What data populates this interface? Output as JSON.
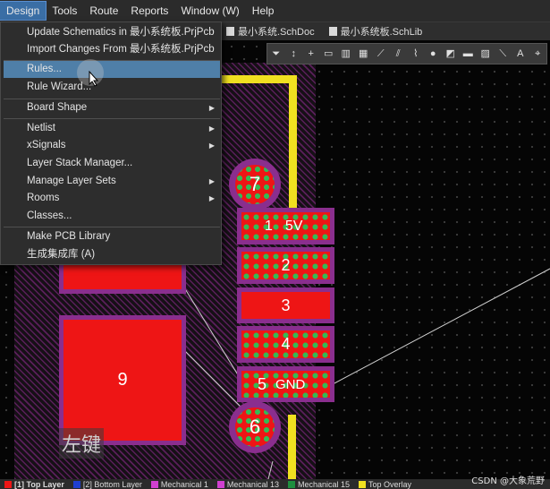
{
  "menubar": {
    "items": [
      "Design",
      "Tools",
      "Route",
      "Reports",
      "Window (W)",
      "Help"
    ]
  },
  "tabs": [
    "最小系统.SchDoc",
    "最小系统板.SchLib"
  ],
  "dropdown": {
    "items": [
      {
        "label": "Update Schematics in 最小系统板.PrjPcb",
        "submenu": false
      },
      {
        "label": "Import Changes From 最小系统板.PrjPcb",
        "submenu": false
      },
      {
        "label": "Rules...",
        "submenu": false,
        "highlighted": true
      },
      {
        "label": "Rule Wizard...",
        "submenu": false
      },
      {
        "label": "Board Shape",
        "submenu": true
      },
      {
        "label": "Netlist",
        "submenu": true
      },
      {
        "label": "xSignals",
        "submenu": true
      },
      {
        "label": "Layer Stack Manager...",
        "submenu": false
      },
      {
        "label": "Manage Layer Sets",
        "submenu": true
      },
      {
        "label": "Rooms",
        "submenu": true
      },
      {
        "label": "Classes...",
        "submenu": false
      },
      {
        "label": "Make PCB Library",
        "submenu": false
      },
      {
        "label": "生成集成库 (A)",
        "submenu": false
      }
    ]
  },
  "pcb": {
    "pads": {
      "p1": "1",
      "p1_net": "5V",
      "p2": "2",
      "p3": "3",
      "p4": "4",
      "p5": "5",
      "p5_net": "GND",
      "p6": "6",
      "p7": "7",
      "p9": "9"
    },
    "colors": {
      "pad": "#ee1515",
      "pad_border": "#8a2e8e",
      "via": "#33bb55",
      "trace": "#f0e020",
      "hatch": "#5a1f5a"
    }
  },
  "hint": "左键",
  "statusbar": {
    "layers": [
      {
        "name": "[1] Top Layer",
        "color": "#ee1515"
      },
      {
        "name": "[2] Bottom Layer",
        "color": "#1f3fd0"
      },
      {
        "name": "Mechanical 1",
        "color": "#d040d0"
      },
      {
        "name": "Mechanical 13",
        "color": "#d040d0"
      },
      {
        "name": "Mechanical 15",
        "color": "#1f8f3f"
      },
      {
        "name": "Top Overlay",
        "color": "#f0e020"
      }
    ]
  },
  "watermark": "CSDN @大象荒野"
}
